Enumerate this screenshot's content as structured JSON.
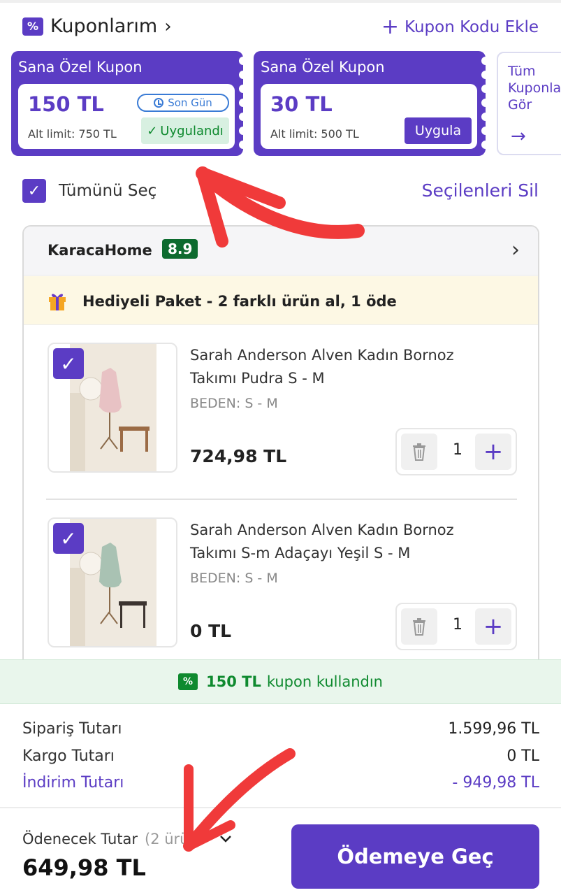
{
  "header": {
    "title": "Kuponlarım",
    "badge_symbol": "%",
    "add_coupon_label": "Kupon Kodu Ekle"
  },
  "coupons": [
    {
      "title": "Sana Özel Kupon",
      "amount": "150 TL",
      "limit": "Alt limit: 750 TL",
      "tag": "Son Gün",
      "action": "Uygulandı"
    },
    {
      "title": "Sana Özel Kupon",
      "amount": "30 TL",
      "limit": "Alt limit: 500 TL",
      "action": "Uygula"
    }
  ],
  "all_coupons_label": "Tüm Kuponları Gör",
  "selection": {
    "select_all_label": "Tümünü Seç",
    "delete_selected_label": "Seçilenleri Sil"
  },
  "seller": {
    "name": "KaracaHome",
    "score": "8.9",
    "promo": "Hediyeli Paket - 2 farklı ürün al, 1 öde"
  },
  "products": [
    {
      "name": "Sarah Anderson Alven Kadın Bornoz Takımı Pudra S - M",
      "size": "BEDEN: S - M",
      "price": "724,98 TL",
      "qty": "1",
      "robe_color": "#e8c2c4"
    },
    {
      "name": "Sarah Anderson Alven Kadın Bornoz Takımı S-m Adaçayı Yeşil S - M",
      "size": "BEDEN: S - M",
      "price": "0 TL",
      "qty": "1",
      "robe_color": "#a9c2b3"
    }
  ],
  "coupon_used": {
    "amount": "150 TL",
    "text": "kupon kullandın"
  },
  "summary": {
    "order_label": "Sipariş Tutarı",
    "order_value": "1.599,96 TL",
    "shipping_label": "Kargo Tutarı",
    "shipping_value": "0 TL",
    "discount_label": "İndirim Tutarı",
    "discount_value": "- 949,98 TL"
  },
  "footer": {
    "payable_label": "Ödenecek Tutar",
    "payable_count": "(2 ürün)",
    "payable_total": "649,98 TL",
    "checkout_label": "Ödemeye Geç"
  },
  "colors": {
    "primary": "#5b3cc4",
    "success": "#0f8a2f",
    "annotation": "#f03a3a"
  }
}
